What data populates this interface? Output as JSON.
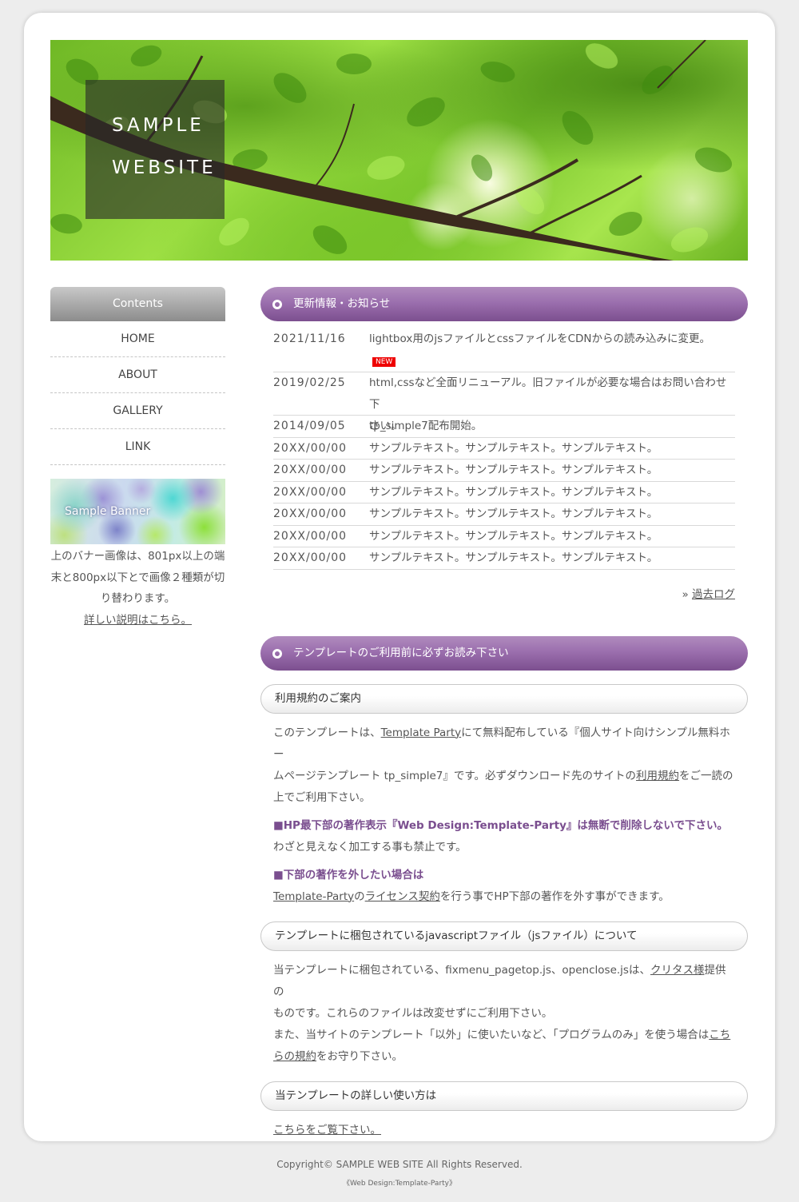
{
  "colors": {
    "accent": "#8e5fa2",
    "new_badge": "#dd0000",
    "background": "#ededed"
  },
  "header": {
    "logo_line1": "SAMPLE",
    "logo_line2": "WEBSITE"
  },
  "sidebar": {
    "title": "Contents",
    "items": [
      {
        "label": "HOME"
      },
      {
        "label": "ABOUT"
      },
      {
        "label": "GALLERY"
      },
      {
        "label": "LINK"
      }
    ],
    "banner_text": "Sample Banner",
    "note_line1": "上のバナー画像は、801px以上の端",
    "note_line2": "末と800px以下とで画像２種類が切",
    "note_line3": "り替わります。",
    "link": "詳しい説明はこちら。"
  },
  "news": {
    "title": "更新情報・お知らせ",
    "badge": "NEW",
    "rows": [
      {
        "date": "2021/11/16",
        "text": "lightbox用のjsファイルとcssファイルをCDNからの読み込みに変更。"
      },
      {
        "date": "2019/02/25",
        "text_line1": "html,cssなど全面リニューアル。旧ファイルが必要な場合はお問い合わせ下",
        "text_line2": "さい。"
      },
      {
        "date": "2014/09/05",
        "text": "tp_simple7配布開始。"
      },
      {
        "date": "20XX/00/00",
        "text": "サンプルテキスト。サンプルテキスト。サンプルテキスト。"
      },
      {
        "date": "20XX/00/00",
        "text": "サンプルテキスト。サンプルテキスト。サンプルテキスト。"
      },
      {
        "date": "20XX/00/00",
        "text": "サンプルテキスト。サンプルテキスト。サンプルテキスト。"
      },
      {
        "date": "20XX/00/00",
        "text": "サンプルテキスト。サンプルテキスト。サンプルテキスト。"
      },
      {
        "date": "20XX/00/00",
        "text": "サンプルテキスト。サンプルテキスト。サンプルテキスト。"
      },
      {
        "date": "20XX/00/00",
        "text": "サンプルテキスト。サンプルテキスト。サンプルテキスト。"
      }
    ],
    "past_prefix": "» ",
    "past_link": "過去ログ"
  },
  "template": {
    "title": "テンプレートのご利用前に必ずお読み下さい",
    "terms_heading": "利用規約のご案内",
    "p1_a": "このテンプレートは、",
    "p1_link": "Template Party",
    "p1_b": "にて無料配布している『個人サイト向けシンプル無料ホー",
    "p1_c": "ムページテンプレート tp_simple7』です。必ずダウンロード先のサイトの",
    "p1_link2": "利用規約",
    "p1_d": "をご一読の",
    "p1_e": "上でご利用下さい。",
    "strong1": "■HP最下部の著作表示『Web Design:Template-Party』は無断で削除しないで下さい。",
    "p2": "わざと見えなく加工する事も禁止です。",
    "strong2": "■下部の著作を外したい場合は",
    "p3_link1": "Template-Party",
    "p3_a": "の",
    "p3_link2": "ライセンス契約",
    "p3_b": "を行う事でHP下部の著作を外す事ができます。",
    "js_heading": "テンプレートに梱包されているjavascriptファイル（jsファイル）について",
    "p4_a": "当テンプレートに梱包されている、fixmenu_pagetop.js、openclose.jsは、",
    "p4_link": "クリタス様",
    "p4_b": "提供の",
    "p4_c": "ものです。これらのファイルは改変せずにご利用下さい。",
    "p5_a": "また、当サイトのテンプレート「以外」に使いたいなど、「プログラムのみ」を使う場合は",
    "p5_link1": "こち",
    "p5_link2": "らの規約",
    "p5_b": "をお守り下さい。",
    "usage_heading": "当テンプレートの詳しい使い方は",
    "usage_link": "こちらをご覧下さい。"
  },
  "footer": {
    "copyright": "Copyright© SAMPLE WEB SITE All Rights Reserved.",
    "credit": "《Web Design:Template-Party》"
  }
}
